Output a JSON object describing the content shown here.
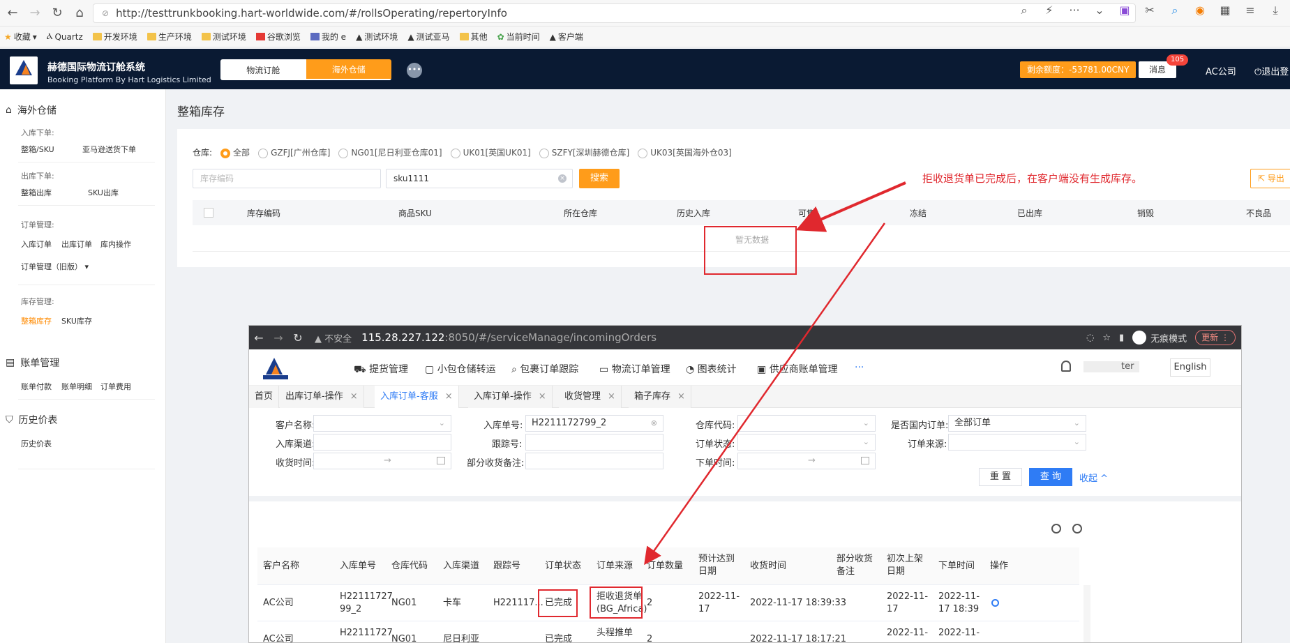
{
  "browser": {
    "url": "http://testtrunkbooking.hart-worldwide.com/#/rollsOperating/repertoryInfo",
    "bookmarks": [
      "收藏",
      "Quartz",
      "开发环境",
      "生产环境",
      "测试环境",
      "谷歌浏览",
      "我的 e",
      "测试环境",
      "测试亚马",
      "其他",
      "当前时间",
      "客户端"
    ]
  },
  "app": {
    "title": "赫德国际物流订舱系统",
    "subtitle": "Booking Platform By Hart Logistics Limited",
    "mode_tabs": [
      "物流订舱",
      "海外仓储"
    ],
    "balance": "剩余额度：-53781.00CNY",
    "message": "消息",
    "message_badge": "105",
    "company": "AC公司",
    "logout": "退出登"
  },
  "sidebar": {
    "section1": "海外仓储",
    "group_inbound": "入库下单:",
    "inbound_items": [
      "整箱/SKU",
      "亚马逊送货下单"
    ],
    "group_outbound": "出库下单:",
    "outbound_items": [
      "整箱出库",
      "SKU出库"
    ],
    "group_orders": "订单管理:",
    "order_items": [
      "入库订单",
      "出库订单",
      "库内操作"
    ],
    "order_legacy": "订单管理（旧版）",
    "group_inventory": "库存管理:",
    "inventory_items": [
      "整箱库存",
      "SKU库存"
    ],
    "section2": "账单管理",
    "bill_items": [
      "账单付款",
      "账单明细",
      "订单费用"
    ],
    "section3": "历史价表",
    "history_items": [
      "历史价表"
    ]
  },
  "main": {
    "page_title": "整箱库存",
    "warehouse_label": "仓库:",
    "warehouses": [
      "全部",
      "GZFJ[广州仓库]",
      "NG01[尼日利亚仓库01]",
      "UK01[英国UK01]",
      "SZFY[深圳赫德仓库]",
      "UK03[英国海外仓03]"
    ],
    "inventory_code_placeholder": "库存编码",
    "sku_value": "sku1111",
    "search_button": "搜索",
    "export_button": "导出",
    "columns": [
      "库存编码",
      "商品SKU",
      "所在仓库",
      "历史入库",
      "可售",
      "冻结",
      "已出库",
      "销毁",
      "不良品"
    ],
    "empty_text": "暂无数据",
    "annotation": "拒收退货单已完成后，在客户端没有生成库存。"
  },
  "embed": {
    "warning": "不安全",
    "url_host": "115.28.227.122",
    "url_rest": ":8050/#/serviceManage/incomingOrders",
    "incognito": "无痕模式",
    "update": "更新",
    "nav": [
      "提货管理",
      "小包仓储转运",
      "包裹订单跟踪",
      "物流订单管理",
      "图表统计",
      "供应商账单管理",
      "···"
    ],
    "user_suffix": "ter",
    "lang": "English",
    "tabs": [
      "首页",
      "出库订单-操作",
      "入库订单-客服",
      "入库订单-操作",
      "收货管理",
      "箱子库存"
    ],
    "form": {
      "customer": "客户名称:",
      "inbound_no": "入库单号:",
      "inbound_no_value": "H2211172799_2",
      "wh_code": "仓库代码:",
      "domestic": "是否国内订单:",
      "domestic_value": "全部订单",
      "channel": "入库渠道:",
      "tracking": "跟踪号:",
      "order_status": "订单状态:",
      "order_source": "订单来源:",
      "receive_time": "收货时间:",
      "partial_note": "部分收货备注:",
      "order_time": "下单时间:",
      "reset": "重 置",
      "query": "查 询",
      "collapse": "收起 ^"
    },
    "columns": [
      "客户名称",
      "入库单号",
      "仓库代码",
      "入库渠道",
      "跟踪号",
      "订单状态",
      "订单来源",
      "订单数量",
      "预计达到日期",
      "收货时间",
      "部分收货备注",
      "初次上架日期",
      "下单时间",
      "操作"
    ],
    "rows": [
      {
        "customer": "AC公司",
        "no1": "H22111727",
        "no2": "99_2",
        "wh": "NG01",
        "channel": "卡车",
        "tracking": "H221117...",
        "status": "已完成",
        "source1": "拒收退货单",
        "source2": "(BG_Africa)",
        "qty": "2",
        "eta1": "2022-11-",
        "eta2": "17",
        "received": "2022-11-17 18:39:33",
        "shelf1": "2022-11-",
        "shelf2": "17",
        "order1": "2022-11-",
        "order2": "17 18:39"
      },
      {
        "customer": "AC公司",
        "no1": "H22111727",
        "wh": "NG01",
        "channel": "尼日利亚",
        "status": "已完成",
        "source1": "头程推单",
        "qty": "2",
        "received": "2022-11-17 18:17:21",
        "shelf1": "2022-11-",
        "order1": "2022-11-"
      }
    ]
  }
}
